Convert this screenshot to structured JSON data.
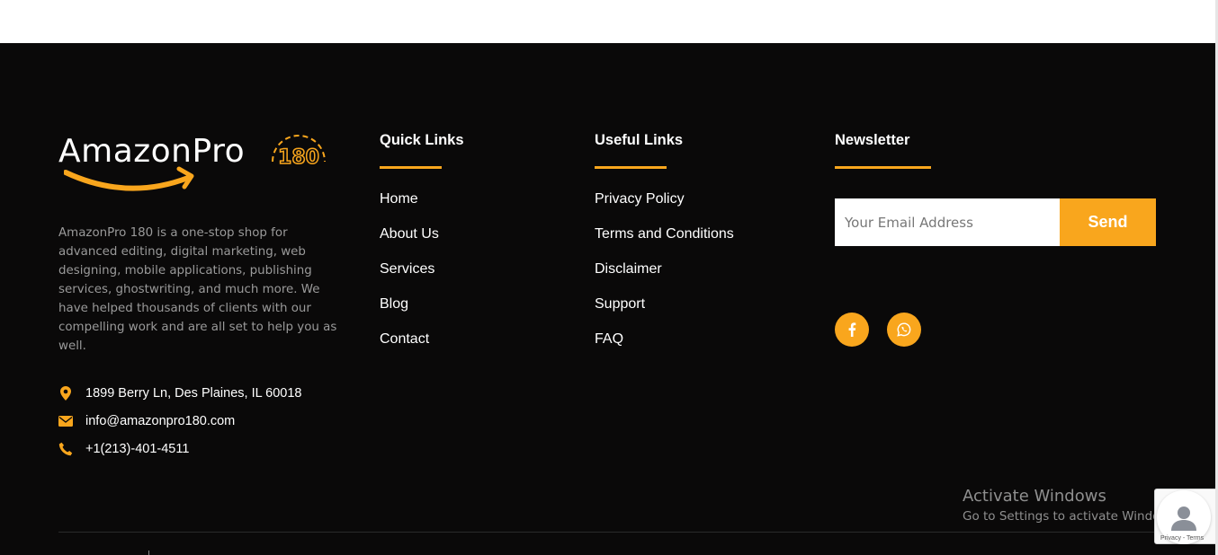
{
  "brand": {
    "logo_word_a": "Amazon",
    "logo_word_b": "Pro",
    "logo_number": "180",
    "accent_color": "#f9a61d",
    "background_color": "#0a0909"
  },
  "about": {
    "text": "AmazonPro 180 is a one-stop shop for advanced editing, digital marketing, web designing, mobile applications, publishing services, ghostwriting, and much more. We have helped thousands of clients with our compelling work and are all set to help you as well."
  },
  "contact": {
    "address": "1899 Berry Ln, Des Plaines, IL 60018",
    "email": "info@amazonpro180.com",
    "phone": "+1(213)-401-4511",
    "icons": [
      "map-pin-icon",
      "envelope-icon",
      "phone-icon"
    ]
  },
  "quick_links": {
    "heading": "Quick Links",
    "items": [
      "Home",
      "About Us",
      "Services",
      "Blog",
      "Contact"
    ]
  },
  "useful_links": {
    "heading": "Useful Links",
    "items": [
      "Privacy Policy",
      "Terms and Conditions",
      "Disclaimer",
      "Support",
      "FAQ"
    ]
  },
  "newsletter": {
    "heading": "Newsletter",
    "email_placeholder": "Your Email Address",
    "email_value": "",
    "send_label": "Send"
  },
  "social": {
    "icons": [
      "facebook-icon",
      "whatsapp-icon"
    ]
  },
  "windows_notice": {
    "title": "Activate Windows",
    "subtitle": "Go to Settings to activate Windows."
  },
  "recaptcha": {
    "label": "Privacy - Terms"
  }
}
